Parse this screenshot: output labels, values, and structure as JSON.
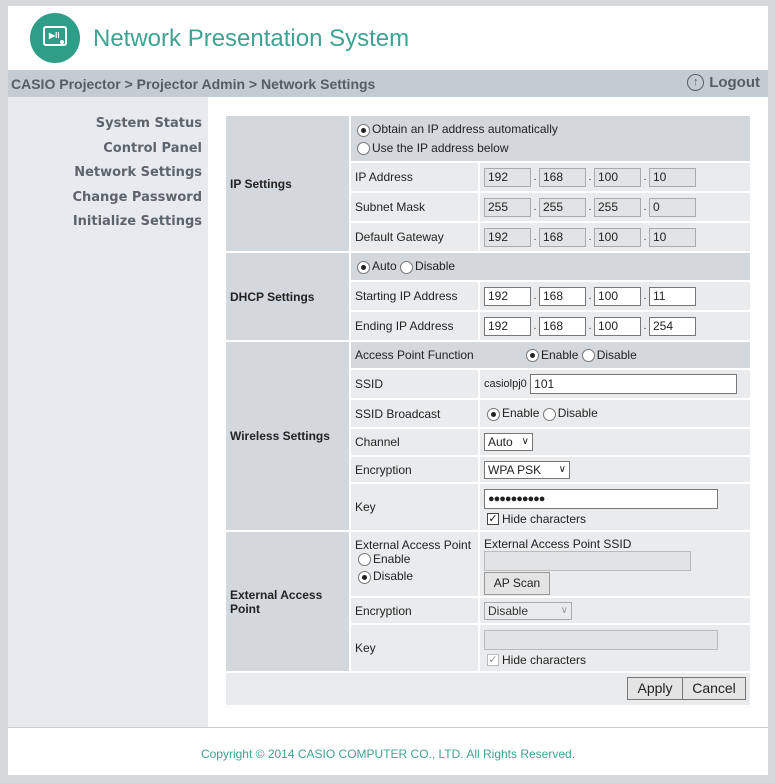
{
  "header": {
    "title": "Network Presentation System",
    "logo_icon": "projector-play-icon"
  },
  "navbar": {
    "breadcrumb": "CASIO Projector > Projector Admin > Network Settings",
    "logout_label": "Logout",
    "logout_icon": "up-arrow-circle-icon"
  },
  "sidebar": {
    "items": [
      {
        "label": "System Status"
      },
      {
        "label": "Control Panel"
      },
      {
        "label": "Network Settings"
      },
      {
        "label": "Change Password"
      },
      {
        "label": "Initialize Settings"
      }
    ]
  },
  "ip_settings": {
    "section_label": "IP Settings",
    "mode_auto_label": "Obtain an IP address automatically",
    "mode_manual_label": "Use the IP address below",
    "selected_mode": "auto",
    "ip_address": {
      "label": "IP Address",
      "octets": [
        "192",
        "168",
        "100",
        "10"
      ]
    },
    "subnet_mask": {
      "label": "Subnet Mask",
      "octets": [
        "255",
        "255",
        "255",
        "0"
      ]
    },
    "default_gateway": {
      "label": "Default Gateway",
      "octets": [
        "192",
        "168",
        "100",
        "10"
      ]
    }
  },
  "dhcp_settings": {
    "section_label": "DHCP Settings",
    "auto_label": "Auto",
    "disable_label": "Disable",
    "selected": "auto",
    "starting_ip": {
      "label": "Starting IP Address",
      "octets": [
        "192",
        "168",
        "100",
        "11"
      ]
    },
    "ending_ip": {
      "label": "Ending IP Address",
      "octets": [
        "192",
        "168",
        "100",
        "254"
      ]
    }
  },
  "wireless_settings": {
    "section_label": "Wireless Settings",
    "access_point_function": {
      "label": "Access Point Function",
      "enable_label": "Enable",
      "disable_label": "Disable",
      "selected": "enable"
    },
    "ssid": {
      "label": "SSID",
      "prefix": "casiolpj0",
      "value": "101"
    },
    "ssid_broadcast": {
      "label": "SSID Broadcast",
      "enable_label": "Enable",
      "disable_label": "Disable",
      "selected": "enable"
    },
    "channel": {
      "label": "Channel",
      "value": "Auto"
    },
    "encryption": {
      "label": "Encryption",
      "value": "WPA PSK"
    },
    "key": {
      "label": "Key",
      "value": "●●●●●●●●●●",
      "hide_label": "Hide characters",
      "hide_checked": true
    }
  },
  "external_access_point": {
    "section_label": "External Access Point",
    "function": {
      "label": "External Access Point",
      "enable_label": "Enable",
      "disable_label": "Disable",
      "selected": "disable"
    },
    "ssid": {
      "label": "External Access Point SSID",
      "value": ""
    },
    "ap_scan_label": "AP Scan",
    "encryption": {
      "label": "Encryption",
      "value": "Disable"
    },
    "key": {
      "label": "Key",
      "value": "",
      "hide_label": "Hide characters",
      "hide_checked": true
    }
  },
  "actions": {
    "apply_label": "Apply",
    "cancel_label": "Cancel"
  },
  "footer": {
    "copyright": "Copyright © 2014 CASIO COMPUTER CO., LTD. All Rights Reserved."
  }
}
